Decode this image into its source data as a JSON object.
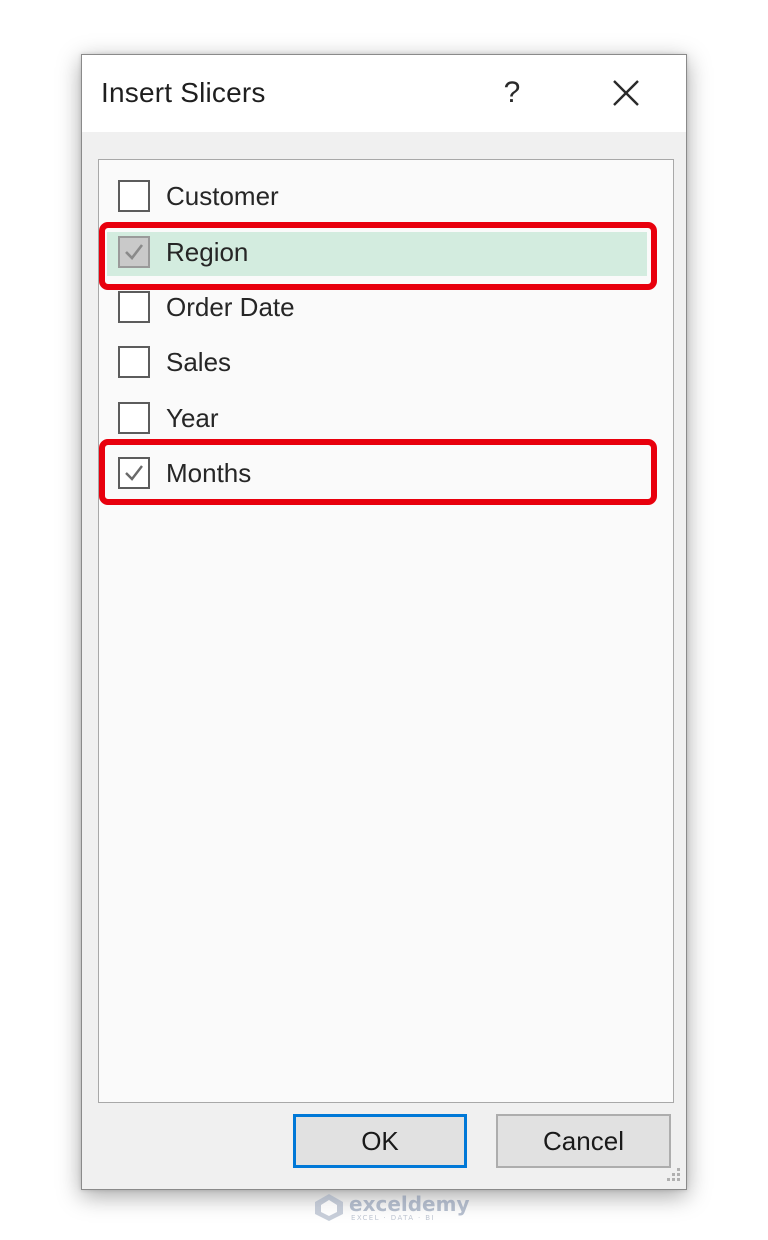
{
  "dialog": {
    "title": "Insert Slicers",
    "help_glyph": "?",
    "close_icon": "close-icon"
  },
  "fields": [
    {
      "label": "Customer",
      "checked": false,
      "selected": false
    },
    {
      "label": "Region",
      "checked": true,
      "selected": true
    },
    {
      "label": "Order Date",
      "checked": false,
      "selected": false
    },
    {
      "label": "Sales",
      "checked": false,
      "selected": false
    },
    {
      "label": "Year",
      "checked": false,
      "selected": false
    },
    {
      "label": "Months",
      "checked": true,
      "selected": false
    }
  ],
  "buttons": {
    "ok": "OK",
    "cancel": "Cancel"
  },
  "watermark": {
    "name": "exceldemy",
    "tagline": "EXCEL · DATA · BI"
  },
  "colors": {
    "highlight_annotation": "#e8000d",
    "selection_background": "#d3ecdf",
    "default_button_border": "#0078d7"
  }
}
